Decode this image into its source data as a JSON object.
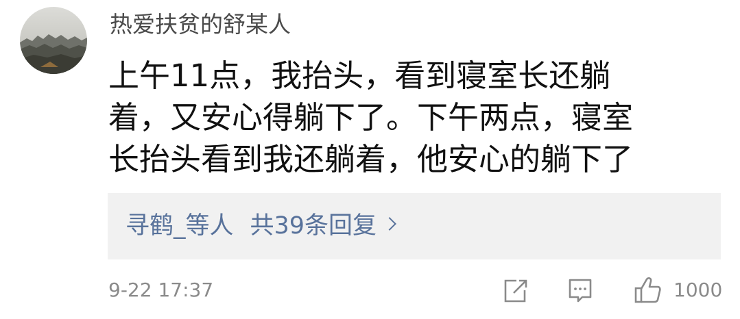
{
  "comment": {
    "username": "热爱扶贫的舒某人",
    "avatar_icon": "landscape-avatar-icon",
    "text_lines": [
      "上午11点，我抬头，看到寝室长还躺",
      "着，又安心得躺下了。下午两点，寝室",
      "长抬头看到我还躺着，他安心的躺下了"
    ],
    "replies": {
      "names": "寻鹤_等人",
      "count_text": "共39条回复",
      "chevron_icon": "chevron-right-icon"
    },
    "timestamp": "9-22 17:37",
    "actions": {
      "share_icon": "share-icon",
      "reply_icon": "comment-icon",
      "like_icon": "thumbs-up-icon",
      "like_count": "1000"
    }
  },
  "colors": {
    "username": "#4a4a4a",
    "body_text": "#111111",
    "link": "#58729b",
    "reply_panel_bg": "#f1f1f1",
    "meta": "#8a8a8a"
  }
}
